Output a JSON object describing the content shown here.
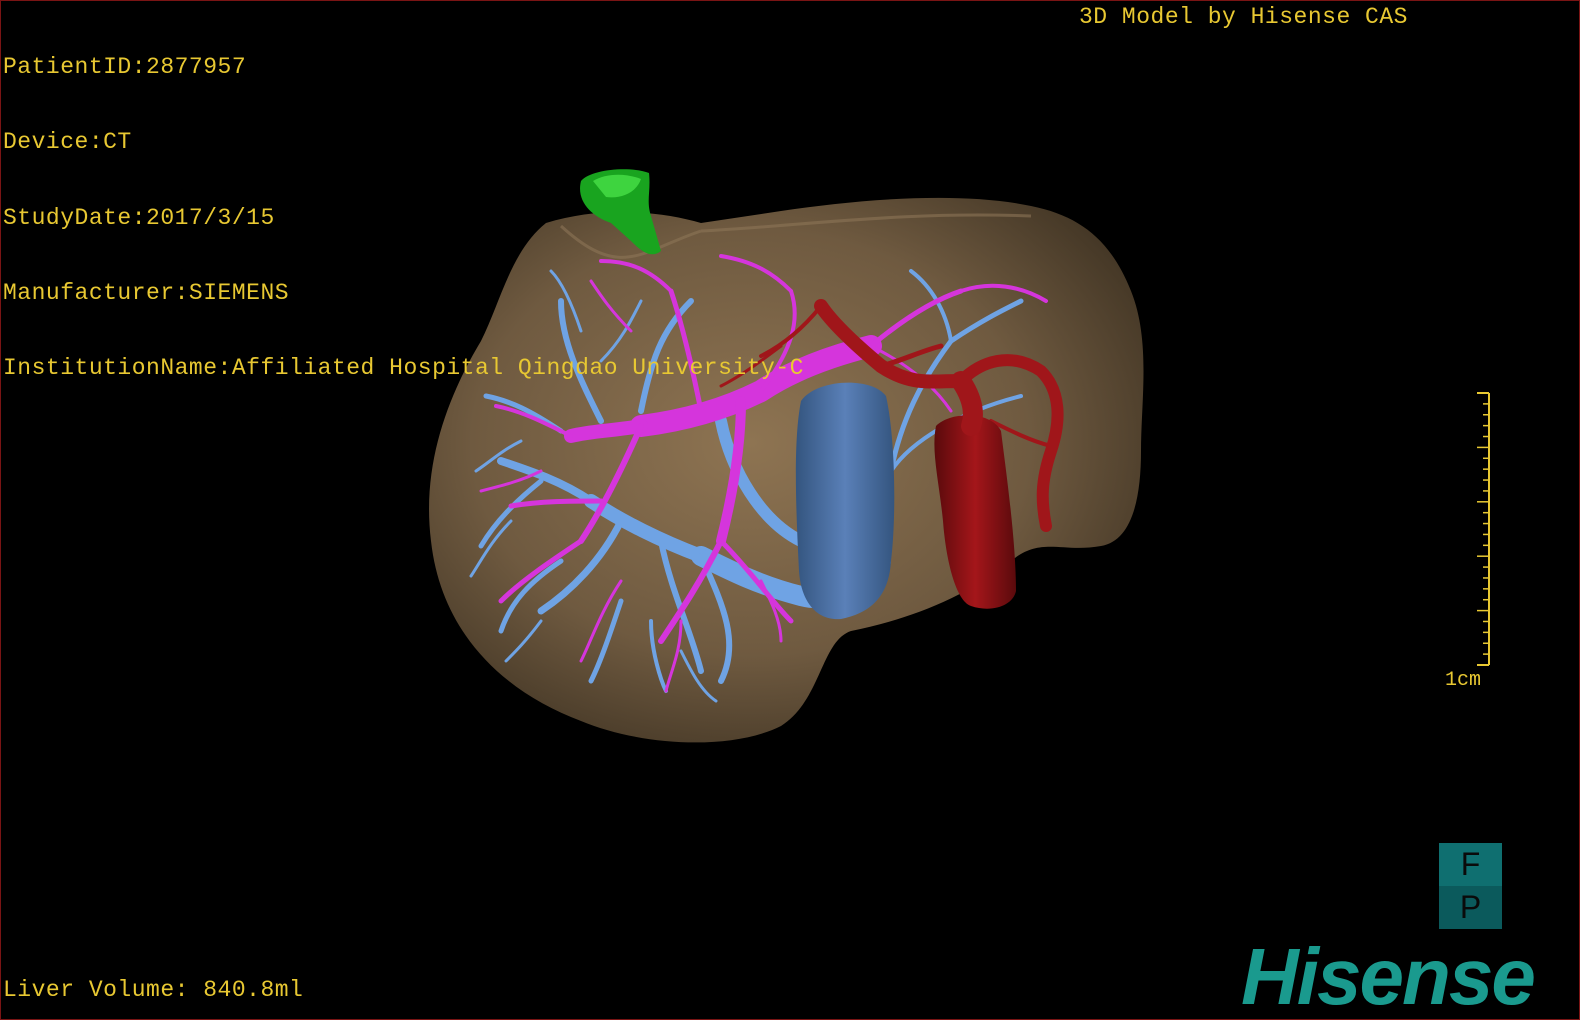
{
  "patient_info": {
    "patient_id": "PatientID:2877957",
    "device": "Device:CT",
    "study_date": "StudyDate:2017/3/15",
    "manufacturer": "Manufacturer:SIEMENS",
    "institution": "InstitutionName:Affiliated Hospital Qingdao University-C"
  },
  "model_credit": "3D Model by Hisense CAS",
  "liver_volume": "Liver Volume: 840.8ml",
  "scale": {
    "label": "1cm"
  },
  "orientation": {
    "top": "F",
    "bottom": "P"
  },
  "brand": "Hisense",
  "colors": {
    "text": "#e8c832",
    "liver": "#7a6448",
    "portal_vein": "#6a9ee0",
    "hepatic_vein": "#d030d8",
    "artery": "#a01418",
    "ivc": "#4870a8",
    "gallbladder": "#1aa020",
    "logo": "#1a9a8e"
  },
  "structures": [
    "liver-surface",
    "gallbladder",
    "portal-vein-tree",
    "hepatic-vein-tree",
    "hepatic-artery",
    "aorta",
    "ivc"
  ]
}
